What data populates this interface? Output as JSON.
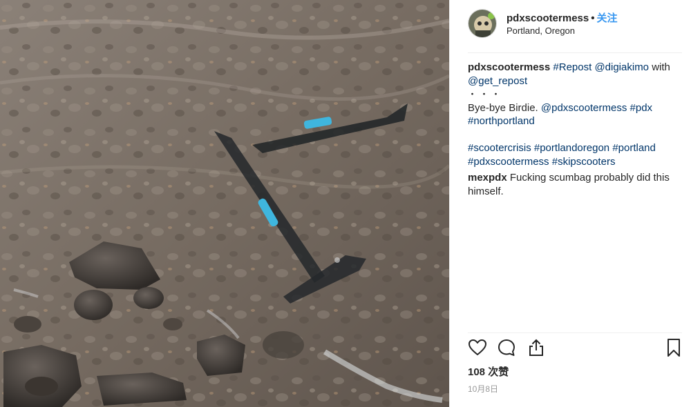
{
  "post": {
    "image_alt": "Scooter lying submerged in shallow river water over rocks",
    "header": {
      "username": "pdxscootermess",
      "separator": "•",
      "follow_label": "关注",
      "location": "Portland, Oregon"
    },
    "caption": {
      "lines": [
        {
          "parts": [
            {
              "text": "pdxscootermess",
              "style": "bold"
            },
            {
              "text": " ",
              "style": "plain"
            },
            {
              "text": "#Repost",
              "style": "link"
            },
            {
              "text": " ",
              "style": "plain"
            },
            {
              "text": "@digiakimo",
              "style": "link"
            },
            {
              "text": " with",
              "style": "plain"
            }
          ]
        },
        {
          "parts": [
            {
              "text": "@get_repost",
              "style": "link"
            }
          ]
        },
        {
          "parts": [
            {
              "text": "・・・",
              "style": "dots"
            }
          ]
        },
        {
          "parts": [
            {
              "text": "Bye-bye Birdie. ",
              "style": "plain"
            },
            {
              "text": "@pdxscootermess",
              "style": "link"
            },
            {
              "text": " ",
              "style": "plain"
            },
            {
              "text": "#pdx",
              "style": "link"
            }
          ]
        },
        {
          "parts": [
            {
              "text": "#northportland",
              "style": "link"
            }
          ]
        },
        {
          "parts": []
        },
        {
          "parts": [
            {
              "text": "#scootercrisis",
              "style": "link"
            },
            {
              "text": " ",
              "style": "plain"
            },
            {
              "text": "#portlandoregon",
              "style": "link"
            },
            {
              "text": " ",
              "style": "plain"
            },
            {
              "text": "#portland",
              "style": "link"
            }
          ]
        },
        {
          "parts": [
            {
              "text": "#pdxscootermess",
              "style": "link"
            },
            {
              "text": " ",
              "style": "plain"
            },
            {
              "text": "#skipscooters",
              "style": "link"
            }
          ]
        }
      ]
    },
    "comments": [
      {
        "lines": [
          {
            "parts": [
              {
                "text": "mexpdx",
                "style": "bold"
              },
              {
                "text": " Fucking scumbag probably did this",
                "style": "plain"
              }
            ]
          },
          {
            "parts": [
              {
                "text": "himself.",
                "style": "plain"
              }
            ]
          }
        ]
      }
    ],
    "actions": {
      "icons": [
        "heart-icon",
        "comment-icon",
        "share-icon",
        "bookmark-icon"
      ]
    },
    "likes_label": "108 次赞",
    "date_label": "10月8日"
  },
  "colors": {
    "link": "#003569",
    "follow": "#3897f0",
    "text": "#262626",
    "muted": "#999999",
    "divider": "#efefef"
  }
}
